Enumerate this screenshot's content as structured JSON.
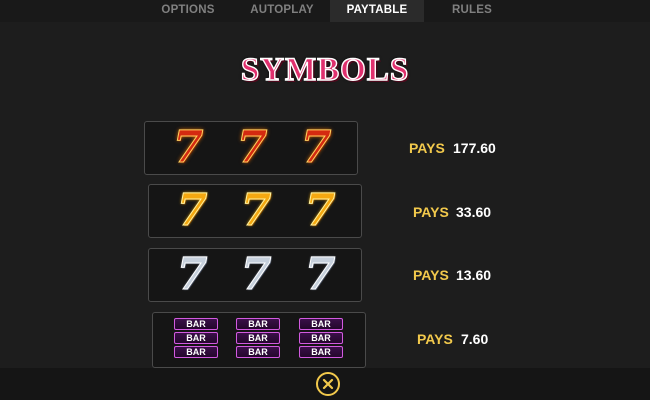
{
  "tabs": [
    {
      "label": "OPTIONS",
      "active": false
    },
    {
      "label": "AUTOPLAY",
      "active": false
    },
    {
      "label": "PAYTABLE",
      "active": true
    },
    {
      "label": "RULES",
      "active": false
    }
  ],
  "title": "SYMBOLS",
  "paytable": [
    {
      "symbol": "red-seven",
      "glyph": "7",
      "count": 3,
      "pays_label": "PAYS",
      "pays_value": "177.60"
    },
    {
      "symbol": "gold-seven",
      "glyph": "7",
      "count": 3,
      "pays_label": "PAYS",
      "pays_value": "33.60"
    },
    {
      "symbol": "silver-seven",
      "glyph": "7",
      "count": 3,
      "pays_label": "PAYS",
      "pays_value": "13.60"
    },
    {
      "symbol": "triple-bar",
      "bar_text": "BAR",
      "count": 3,
      "pays_label": "PAYS",
      "pays_value": "7.60"
    }
  ],
  "colors": {
    "background": "#1d1d1d",
    "title": "#e0306e",
    "pays_label": "#f2c94c",
    "pays_value": "#ffffff",
    "tab_active_bg": "#2b2b2b",
    "bar_border": "#d25ae0"
  },
  "close_button": {
    "icon": "close-icon"
  }
}
